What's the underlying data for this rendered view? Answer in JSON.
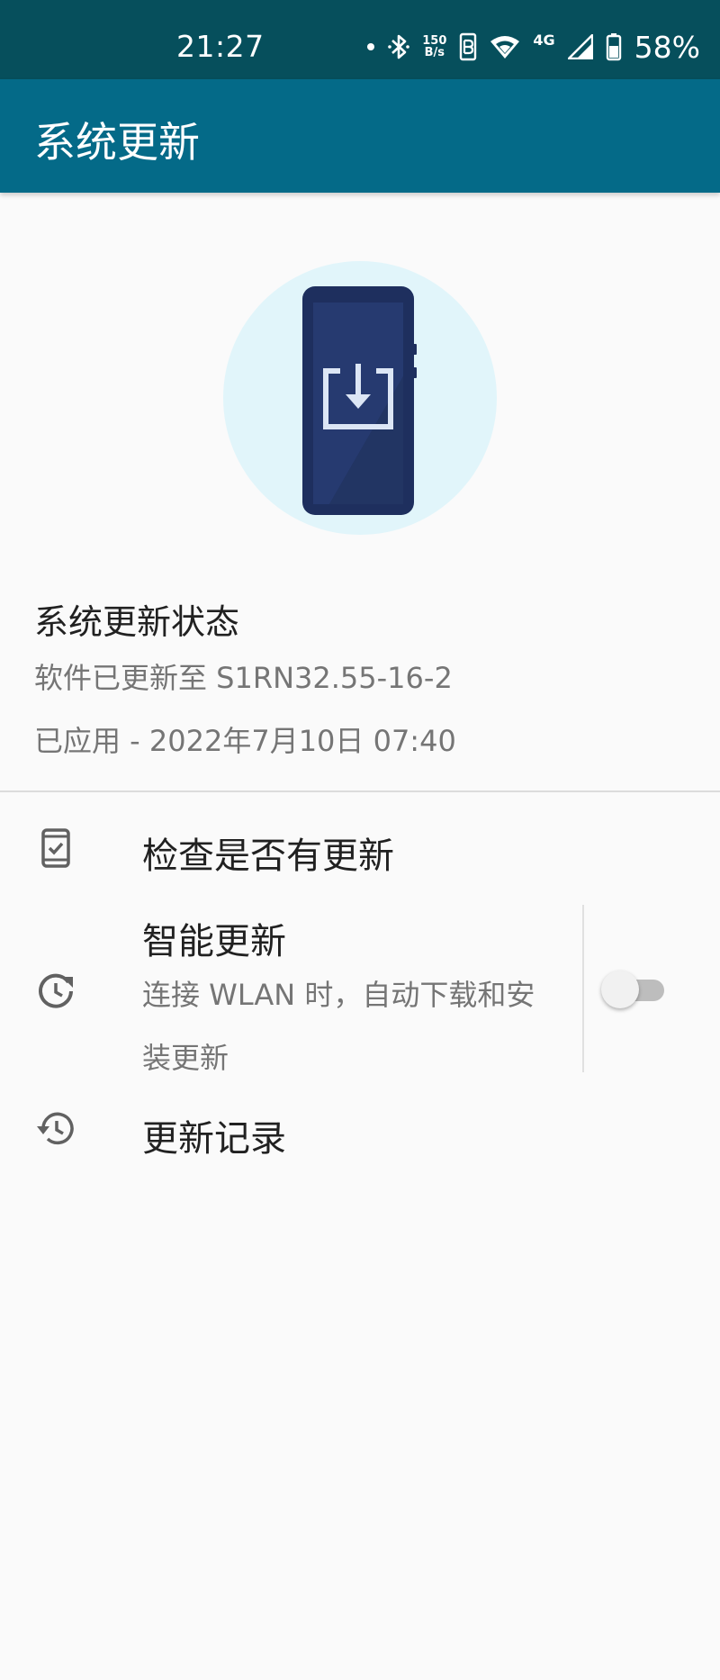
{
  "status_bar": {
    "time": "21:27",
    "net_speed_value": "150",
    "net_speed_unit": "B/s",
    "network_type": "4G",
    "battery_percent": "58%",
    "icons": [
      "notification-dot-icon",
      "bluetooth-icon",
      "hd-icon",
      "wifi-icon",
      "signal-icon",
      "battery-icon"
    ]
  },
  "app_bar": {
    "title": "系统更新"
  },
  "hero": {
    "icon": "phone-download-icon",
    "colors": {
      "circle": "#e1f5fa",
      "phone_body": "#1e2f5e",
      "phone_screen": "#263a70"
    }
  },
  "update_status": {
    "title": "系统更新状态",
    "version_line": "软件已更新至 S1RN32.55-16-2",
    "applied_line": "已应用 - 2022年7月10日 07:40"
  },
  "list": {
    "check_update": {
      "icon": "phone-check-icon",
      "title": "检查是否有更新"
    },
    "smart_update": {
      "icon": "clock-refresh-icon",
      "title": "智能更新",
      "summary": "连接 WLAN 时，自动下载和安装更新",
      "toggle_on": false
    },
    "update_history": {
      "icon": "history-icon",
      "title": "更新记录"
    }
  },
  "colors": {
    "status_bar": "#064f5c",
    "app_bar": "#046a88",
    "background": "#fafafa",
    "primary_text": "#212121",
    "secondary_text": "#757575"
  }
}
